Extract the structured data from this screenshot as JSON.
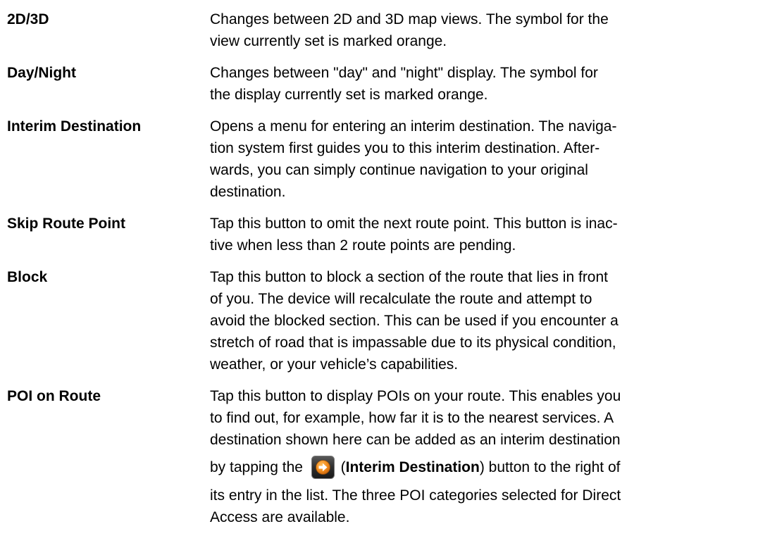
{
  "entries": [
    {
      "term": "2D/3D",
      "lines": [
        "Changes between 2D and 3D map views. The symbol for the",
        "view currently set is marked orange."
      ]
    },
    {
      "term": "Day/Night",
      "lines": [
        "Changes between \"day\" and \"night\" display. The symbol for",
        "the display currently set is marked orange."
      ]
    },
    {
      "term": "Interim Destination",
      "lines": [
        "Opens a menu for entering an interim destination. The naviga-",
        "tion system first guides you to this interim destination. After-",
        "wards, you can simply continue navigation to your original",
        "destination."
      ]
    },
    {
      "term": "Skip Route Point",
      "lines": [
        "Tap this button to omit the next route point. This button is inac-",
        "tive when less than 2 route points are pending."
      ]
    },
    {
      "term": "Block",
      "lines": [
        "Tap this button to block a section of the route that lies in front",
        "of you. The device will recalculate the route and attempt to",
        "avoid the blocked section. This can be used if you encounter a",
        "stretch of road that is impassable due to its physical condition,",
        "weather, or your vehicle’s capabilities."
      ]
    },
    {
      "term": "POI on Route",
      "lines": [
        "Tap this button to display POIs on your route. This enables you",
        "to find out, for example, how far it is to the nearest services. A",
        "destination shown here can be added as an interim destination"
      ],
      "button_line": {
        "before": "by tapping the",
        "paren_open": "(",
        "button_name": "Interim Destination",
        "paren_close": ")",
        "after": "button to the right of"
      },
      "lines_after": [
        "its entry in the list. The three POI categories selected for Direct",
        "Access are available."
      ],
      "icon": "interim-destination-arrow-icon",
      "icon_color": "#f08a1c"
    }
  ]
}
